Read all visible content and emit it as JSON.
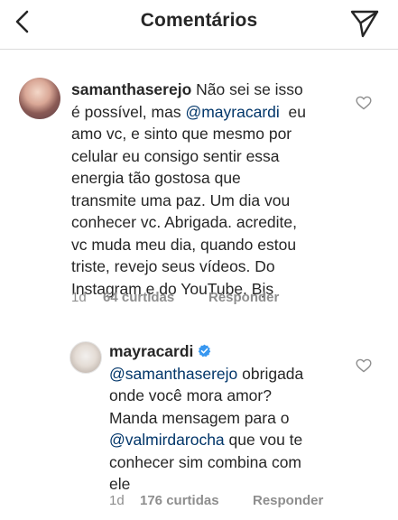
{
  "header": {
    "title": "Comentários",
    "back_icon": "chevron-left-icon",
    "send_icon": "paper-plane-icon"
  },
  "comments": [
    {
      "username": "samanthaserejo",
      "avatar_icon": "user-avatar",
      "lines": [
        {
          "username": "samanthaserejo",
          "text": " Não sei se isso"
        },
        {
          "text": "é possível, mas ",
          "mention": "@mayracardi",
          "text_after": "  eu"
        },
        {
          "text": "amo vc, e sinto que mesmo por"
        },
        {
          "text": "celular eu consigo sentir essa"
        },
        {
          "text": "energia tão gostosa que"
        },
        {
          "text": "transmite uma paz. Um dia vou"
        },
        {
          "text": "conhecer vc. Abrigada. acredite,"
        },
        {
          "text": "vc muda meu dia, quando estou"
        },
        {
          "text": "triste, revejo seus vídeos. Do"
        },
        {
          "text": "Instagram e do YouTube. Bjs"
        }
      ],
      "time": "1d",
      "likes": "64 curtidas",
      "reply": "Responder",
      "like_icon": "heart-outline-icon"
    },
    {
      "username": "mayracardi",
      "verified_icon": "verified-badge-icon",
      "avatar_icon": "user-avatar",
      "lines": [
        {
          "mention": "@samanthaserejo",
          "text_after": " obrigada"
        },
        {
          "text": "onde você mora amor?"
        },
        {
          "text": "Manda mensagem para o"
        },
        {
          "mention": "@valmirdarocha",
          "text_after": " que vou te"
        },
        {
          "text": "conhecer sim combina com"
        },
        {
          "text": "ele"
        }
      ],
      "time": "1d",
      "likes": "176 curtidas",
      "reply": "Responder",
      "like_icon": "heart-outline-icon"
    }
  ],
  "colors": {
    "text": "#262626",
    "mention": "#003569",
    "meta": "#8e8e8e",
    "divider": "#dbdbdb",
    "verified": "#3897f0"
  }
}
